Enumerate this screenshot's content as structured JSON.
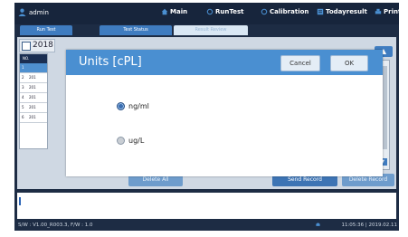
{
  "topbar": {
    "user": "admin",
    "nav": [
      {
        "label": "Main",
        "icon": "home-icon"
      },
      {
        "label": "RunTest",
        "icon": "refresh-icon"
      },
      {
        "label": "Calibration",
        "icon": "calibration-icon"
      },
      {
        "label": "Todayresult",
        "icon": "list-icon"
      },
      {
        "label": "Print",
        "icon": "printer-icon"
      }
    ]
  },
  "tabs": [
    "Run Test",
    "Test Status",
    "Result Review"
  ],
  "review": {
    "year": "2018",
    "table_header": "NO.",
    "rows": [
      {
        "n": "1",
        "d": "",
        "selected": true
      },
      {
        "n": "2",
        "d": "201"
      },
      {
        "n": "3",
        "d": "201"
      },
      {
        "n": "4",
        "d": "201"
      },
      {
        "n": "5",
        "d": "201"
      },
      {
        "n": "6",
        "d": "201"
      }
    ],
    "buttons": {
      "delete_all": "Delete All",
      "send_record": "Send Record",
      "delete_record": "Delete Record"
    }
  },
  "dialog": {
    "title": "Units  [cPL]",
    "cancel": "Cancel",
    "ok": "OK",
    "options": [
      {
        "label": "ng/ml",
        "selected": true
      },
      {
        "label": "ug/L",
        "selected": false
      }
    ]
  },
  "status": {
    "version": "S/W : V1.00_R003.3, F/W : 1.0",
    "datetime": "11:05:36 | 2019.02.11"
  },
  "colors": {
    "header_dark": "#17253c",
    "accent_blue": "#4a8fd1",
    "tab_blue": "#3f7cc0"
  }
}
